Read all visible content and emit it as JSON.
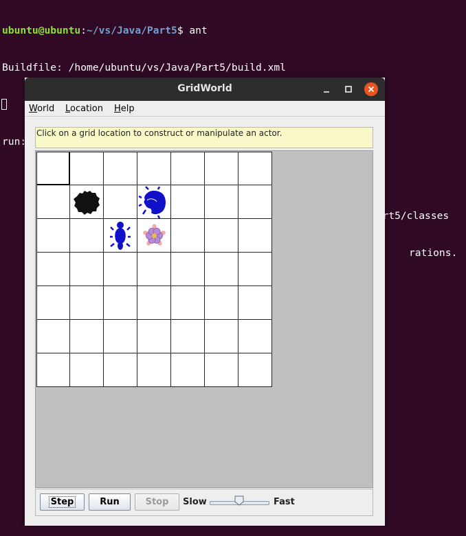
{
  "terminal": {
    "prompt_user": "ubuntu@ubuntu",
    "prompt_sep": ":",
    "prompt_path": "~/vs/Java/Part5",
    "prompt_cmd": "$ ant",
    "line2": "Buildfile: /home/ubuntu/vs/Java/Part5/build.xml",
    "line3": "",
    "line4": "run:",
    "line5": "    [mkdir] Created dir: /home/ubuntu/vs/Java/Part5/classes",
    "line6": "    [javac] Compiling 5 source files to /home/ubuntu/vs/Java/Part5/classes",
    "line7_visible": "rations."
  },
  "window": {
    "title": "GridWorld",
    "menus": [
      {
        "label": "World",
        "mnemonic": "W",
        "rest": "orld"
      },
      {
        "label": "Location",
        "mnemonic": "L",
        "rest": "ocation"
      },
      {
        "label": "Help",
        "mnemonic": "H",
        "rest": "elp"
      }
    ],
    "message": "Click on a grid location to construct or manipulate an actor.",
    "grid": {
      "rows": 7,
      "cols": 7,
      "selected": [
        0,
        0
      ],
      "actors": [
        {
          "kind": "rock",
          "row": 1,
          "col": 1,
          "color": "#111111"
        },
        {
          "kind": "bug",
          "row": 1,
          "col": 3,
          "color": "#1010c8",
          "heading": "west"
        },
        {
          "kind": "bug",
          "row": 2,
          "col": 2,
          "color": "#1010c8",
          "heading": "north"
        },
        {
          "kind": "flower",
          "row": 2,
          "col": 3,
          "color": "#f3a9a9"
        }
      ]
    },
    "controls": {
      "step": "Step",
      "run": "Run",
      "stop": "Stop",
      "slow": "Slow",
      "fast": "Fast",
      "speed_fraction": 0.5
    }
  }
}
